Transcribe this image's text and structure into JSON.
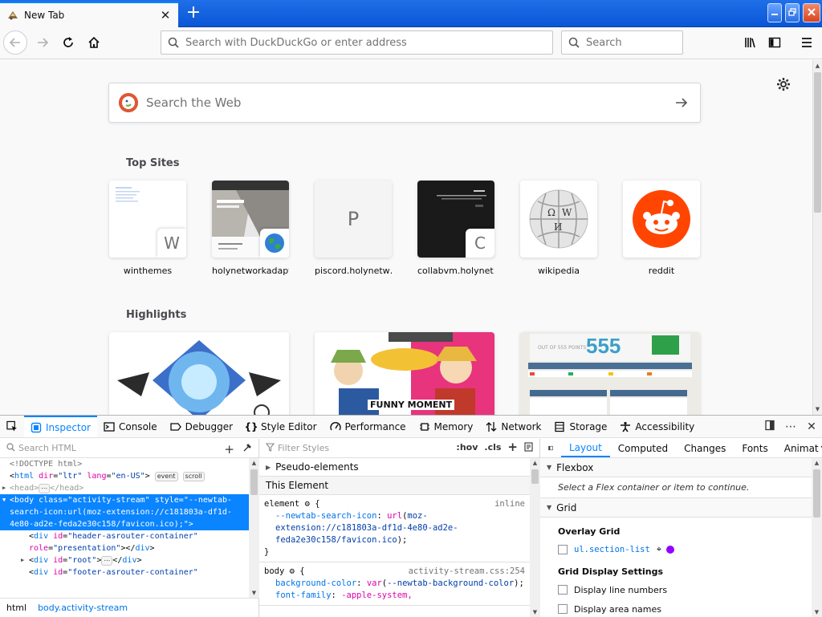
{
  "tab": {
    "title": "New Tab",
    "close": "✕"
  },
  "window": {
    "new_tab": "+"
  },
  "toolbar": {
    "url_placeholder": "Search with DuckDuckGo or enter address",
    "search_placeholder": "Search"
  },
  "newtab": {
    "search_placeholder": "Search the Web",
    "topsites_title": "Top Sites",
    "highlights_title": "Highlights",
    "sites": [
      {
        "label": "winthemes",
        "badge": "W"
      },
      {
        "label": "holynetworkadapt…",
        "badge": ""
      },
      {
        "label": "piscord.holynetw…",
        "letter": "P"
      },
      {
        "label": "collabvm.holynet…",
        "badge": "C"
      },
      {
        "label": "wikipedia"
      },
      {
        "label": "reddit"
      }
    ],
    "highlight_images": {
      "promo_text": "FUNNY MOMENT",
      "score_value": "555",
      "score_caption": "OUT OF 555 POINTS"
    }
  },
  "devtools": {
    "tabs": [
      "Inspector",
      "Console",
      "Debugger",
      "Style Editor",
      "Performance",
      "Memory",
      "Network",
      "Storage",
      "Accessibility"
    ],
    "markup": {
      "search_placeholder": "Search HTML",
      "doctype": "<!DOCTYPE html>",
      "html_tag": "html",
      "html_attr": "dir",
      "html_attr_val": "\"ltr\"",
      "html_attr2": "lang",
      "html_attr2_val": "\"en-US\"",
      "pill_event": "event",
      "pill_scroll": "scroll",
      "head_tag": "head",
      "body_attr_class": "class",
      "body_class_val": "\"activity-stream\"",
      "body_attr_style": "style",
      "body_style_val": "\"--newtab-search-icon:url(moz-extension://c181803a-df1d-4e80-ad2e-feda2e30c158/favicon.ico);\"",
      "div1_id": "\"header-asrouter-container\"",
      "div1_role": "\"presentation\"",
      "div2_id": "\"root\"",
      "div3_id": "\"footer-asrouter-container\"",
      "ellipsis": "⋯",
      "breadcrumbs": [
        "html",
        "body.activity-stream"
      ]
    },
    "rules": {
      "filter_placeholder": "Filter Styles",
      "hov": ":hov",
      "cls": ".cls",
      "pseudo": "Pseudo-elements",
      "this_element": "This Element",
      "element_selector": "element",
      "inline": "inline",
      "element_prop": "--newtab-search-icon",
      "element_val_fn": "url",
      "element_val": "moz-extension://c181803a-df1d-4e80-ad2e-feda2e30c158/favicon.ico",
      "body_selector": "body",
      "body_source": "activity-stream.css:254",
      "bg_prop": "background-color",
      "bg_fn": "var",
      "bg_var": "--newtab-background-color",
      "font_prop": "font-family",
      "font_val": "-apple-system,"
    },
    "layout": {
      "tabs": [
        "Layout",
        "Computed",
        "Changes",
        "Fonts",
        "Animat"
      ],
      "flexbox": "Flexbox",
      "flex_note": "Select a Flex container or item to continue.",
      "grid": "Grid",
      "overlay_grid": "Overlay Grid",
      "grid_item": "ul.section-list",
      "grid_color": "#9400ff",
      "display_settings": "Grid Display Settings",
      "opt_line_numbers": "Display line numbers",
      "opt_area_names": "Display area names"
    }
  },
  "colors": {
    "accent": "#0a84ff",
    "selected_row": "#0a84ff",
    "reddit": "#ff4500",
    "duckduckgo": "#de5833"
  }
}
